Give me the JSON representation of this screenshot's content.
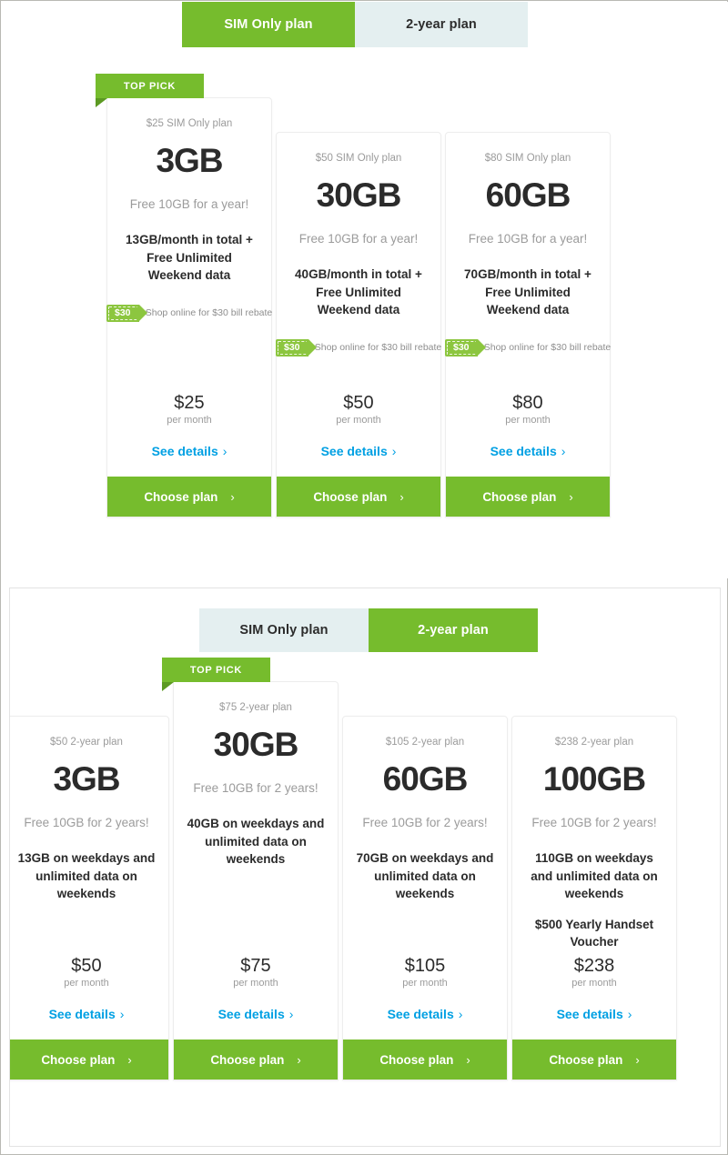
{
  "colors": {
    "brand_green": "#76bc2d",
    "tab_inactive_bg": "#e4eff0",
    "link_blue": "#00a0e3",
    "rebate_green": "#8cc63f",
    "muted_text": "#9b9b9b",
    "dark_text": "#2b2b2b"
  },
  "common": {
    "top_pick_label": "TOP PICK",
    "see_details_label": "See details",
    "choose_plan_label": "Choose plan",
    "per_month_label": "per month",
    "chevron": "›"
  },
  "section_one": {
    "tabs": [
      {
        "label": "SIM Only plan",
        "active": true
      },
      {
        "label": "2-year plan",
        "active": false
      }
    ],
    "cards": [
      {
        "top_pick": true,
        "plan_label": "$25 SIM Only plan",
        "data_amount": "3GB",
        "free_offer": "Free 10GB for a year!",
        "detail": "13GB/month in total + Free Unlimited Weekend data",
        "rebate_amount": "$30",
        "rebate_text": "Shop online for $30 bill rebate",
        "price": "$25",
        "per_month": "per month",
        "see_details": "See details",
        "choose_plan": "Choose plan"
      },
      {
        "top_pick": false,
        "plan_label": "$50 SIM Only plan",
        "data_amount": "30GB",
        "free_offer": "Free 10GB for a year!",
        "detail": "40GB/month in total + Free Unlimited Weekend data",
        "rebate_amount": "$30",
        "rebate_text": "Shop online for $30 bill rebate",
        "price": "$50",
        "per_month": "per month",
        "see_details": "See details",
        "choose_plan": "Choose plan"
      },
      {
        "top_pick": false,
        "plan_label": "$80 SIM Only plan",
        "data_amount": "60GB",
        "free_offer": "Free 10GB for a year!",
        "detail": "70GB/month in total + Free Unlimited Weekend data",
        "rebate_amount": "$30",
        "rebate_text": "Shop online for $30 bill rebate",
        "price": "$80",
        "per_month": "per month",
        "see_details": "See details",
        "choose_plan": "Choose plan"
      }
    ]
  },
  "section_two": {
    "tabs": [
      {
        "label": "SIM Only plan",
        "active": false
      },
      {
        "label": "2-year plan",
        "active": true
      }
    ],
    "cards": [
      {
        "top_pick": false,
        "plan_label": "$50 2-year plan",
        "data_amount": "3GB",
        "free_offer": "Free 10GB for 2 years!",
        "detail": "13GB on weekdays and unlimited data on weekends",
        "detail_2": "",
        "price": "$50",
        "per_month": "per month",
        "see_details": "See details",
        "choose_plan": "Choose plan"
      },
      {
        "top_pick": true,
        "plan_label": "$75 2-year plan",
        "data_amount": "30GB",
        "free_offer": "Free 10GB for 2 years!",
        "detail": "40GB on weekdays and unlimited data on weekends",
        "detail_2": "",
        "price": "$75",
        "per_month": "per month",
        "see_details": "See details",
        "choose_plan": "Choose plan"
      },
      {
        "top_pick": false,
        "plan_label": "$105 2-year plan",
        "data_amount": "60GB",
        "free_offer": "Free 10GB for 2 years!",
        "detail": "70GB on weekdays and unlimited data on weekends",
        "detail_2": "",
        "price": "$105",
        "per_month": "per month",
        "see_details": "See details",
        "choose_plan": "Choose plan"
      },
      {
        "top_pick": false,
        "plan_label": "$238 2-year plan",
        "data_amount": "100GB",
        "free_offer": "Free 10GB for 2 years!",
        "detail": "110GB on weekdays and unlimited data on weekends",
        "detail_2": "$500 Yearly Handset Voucher",
        "price": "$238",
        "per_month": "per month",
        "see_details": "See details",
        "choose_plan": "Choose plan"
      }
    ]
  }
}
